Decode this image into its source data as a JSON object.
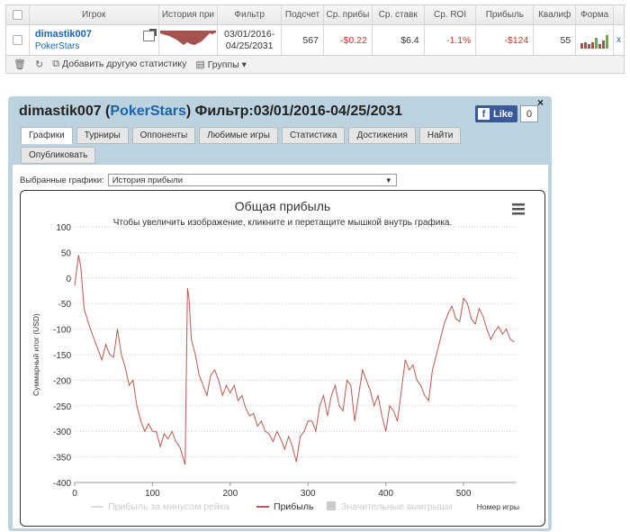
{
  "table": {
    "headers": [
      "Игрок",
      "История при",
      "Фильтр",
      "Подсчет",
      "Ср. прибы",
      "Ср. ставк",
      "Ср. ROI",
      "Прибыль",
      "Квалиф",
      "Форма"
    ],
    "row": {
      "player": "dimastik007",
      "site": "PokerStars",
      "filter_line1": "03/01/2016-",
      "filter_line2": "04/25/2031",
      "count": "567",
      "avg_profit": "-$0.22",
      "avg_stake": "$6.4",
      "avg_roi": "-1.1%",
      "profit": "-$124",
      "qual": "55",
      "form": [
        {
          "h": 6,
          "c": "#a5524f"
        },
        {
          "h": 7,
          "c": "#a5524f"
        },
        {
          "h": 5,
          "c": "#a5524f"
        },
        {
          "h": 7,
          "c": "#a5524f"
        },
        {
          "h": 12,
          "c": "#6aa84f"
        },
        {
          "h": 5,
          "c": "#a5524f"
        },
        {
          "h": 9,
          "c": "#a5524f"
        },
        {
          "h": 15,
          "c": "#6aa84f"
        }
      ],
      "remove": "x"
    },
    "toolbar": {
      "add_stats": "Добавить другую статистику",
      "groups": "Группы"
    }
  },
  "panel": {
    "title_player": "dimastik007 (",
    "title_site": "PokerStars",
    "title_rest": ") Фильтр:03/01/2016-04/25/2031",
    "like_label": "Like",
    "like_count": "0",
    "close": "×",
    "tabs": [
      "Графики",
      "Турниры",
      "Оппоненты",
      "Любимые игры",
      "Статистика",
      "Достижения",
      "Найти",
      "Опубликовать"
    ],
    "active_tab": 0,
    "selector_label": "Выбранные графики:",
    "selector_value": "История прибыли"
  },
  "colors": {
    "profit_line": "#b85a52",
    "panel_bg": "#bcd2de",
    "link": "#1a64a8"
  },
  "chart_data": {
    "type": "line",
    "title": "Общая прибыль",
    "subtitle": "Чтобы увеличить изображение, кликните и перетащите мышкой внутрь графика.",
    "ylabel": "Суммарный итог (USD)",
    "xlabel": "Номер игры",
    "xlim": [
      0,
      567
    ],
    "ylim": [
      -400,
      100
    ],
    "xticks": [
      0,
      100,
      200,
      300,
      400,
      500
    ],
    "yticks": [
      100,
      50,
      0,
      -50,
      -100,
      -150,
      -200,
      -250,
      -300,
      -350,
      -400
    ],
    "grid": "horizontal dotted",
    "legend_position": "bottom",
    "legend": [
      "Прибыль за минусом рейка",
      "Прибыль",
      "Значительные выигрыши"
    ],
    "series": [
      {
        "name": "Прибыль",
        "x": [
          0,
          5,
          8,
          12,
          18,
          25,
          30,
          35,
          40,
          45,
          50,
          55,
          60,
          65,
          70,
          75,
          80,
          85,
          90,
          95,
          100,
          105,
          110,
          115,
          120,
          125,
          130,
          135,
          140,
          142,
          145,
          147,
          150,
          155,
          160,
          165,
          170,
          175,
          180,
          185,
          190,
          195,
          200,
          205,
          210,
          215,
          220,
          225,
          230,
          235,
          240,
          245,
          250,
          255,
          260,
          265,
          270,
          275,
          280,
          285,
          290,
          295,
          300,
          305,
          310,
          315,
          320,
          325,
          330,
          335,
          340,
          345,
          350,
          355,
          360,
          365,
          370,
          375,
          380,
          385,
          390,
          395,
          400,
          405,
          410,
          415,
          420,
          425,
          430,
          435,
          440,
          445,
          450,
          455,
          460,
          465,
          470,
          475,
          480,
          485,
          490,
          495,
          500,
          505,
          510,
          515,
          520,
          525,
          530,
          535,
          540,
          545,
          550,
          555,
          560,
          565
        ],
        "values": [
          -15,
          45,
          20,
          -60,
          -90,
          -120,
          -140,
          -160,
          -130,
          -150,
          -155,
          -100,
          -150,
          -175,
          -210,
          -200,
          -250,
          -280,
          -300,
          -285,
          -300,
          -300,
          -330,
          -305,
          -315,
          -300,
          -320,
          -330,
          -355,
          -365,
          -20,
          -40,
          -120,
          -150,
          -190,
          -210,
          -230,
          -190,
          -180,
          -200,
          -230,
          -210,
          -225,
          -210,
          -240,
          -230,
          -255,
          -270,
          -265,
          -290,
          -280,
          -300,
          -305,
          -320,
          -300,
          -315,
          -335,
          -310,
          -330,
          -360,
          -310,
          -300,
          -280,
          -280,
          -300,
          -250,
          -230,
          -270,
          -230,
          -210,
          -250,
          -260,
          -200,
          -210,
          -280,
          -230,
          -180,
          -200,
          -220,
          -250,
          -230,
          -270,
          -300,
          -250,
          -260,
          -280,
          -220,
          -160,
          -180,
          -170,
          -200,
          -210,
          -230,
          -240,
          -180,
          -150,
          -120,
          -90,
          -70,
          -55,
          -80,
          -85,
          -40,
          -50,
          -80,
          -90,
          -60,
          -75,
          -100,
          -120,
          -105,
          -95,
          -110,
          -100,
          -120,
          -125
        ]
      }
    ]
  }
}
